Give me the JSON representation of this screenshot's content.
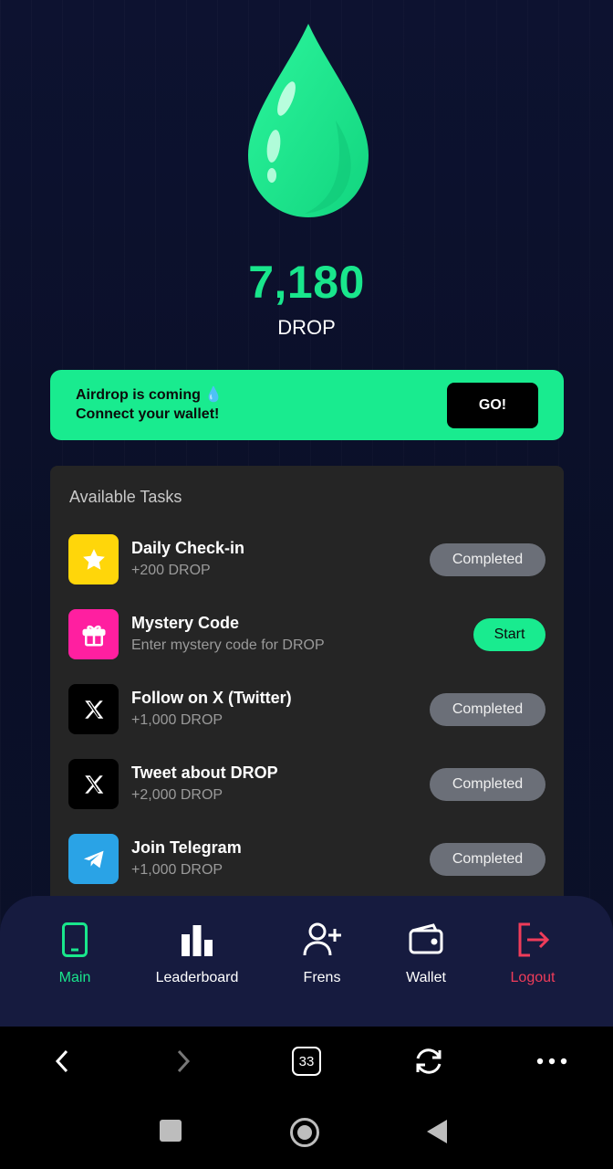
{
  "balance": {
    "amount": "7,180",
    "unit": "DROP"
  },
  "banner": {
    "line1": "Airdrop is coming 💧",
    "line2": "Connect your wallet!",
    "button": "GO!"
  },
  "tasks": {
    "title": "Available Tasks",
    "items": [
      {
        "name": "Daily Check-in",
        "sub": "+200 DROP",
        "status": "Completed",
        "icon": "star-icon",
        "color": "#ffd60a"
      },
      {
        "name": "Mystery Code",
        "sub": "Enter mystery code for DROP",
        "status": "Start",
        "icon": "gift-icon",
        "color": "#ff1fa0"
      },
      {
        "name": "Follow on X (Twitter)",
        "sub": "+1,000 DROP",
        "status": "Completed",
        "icon": "x-logo-icon",
        "color": "#000000"
      },
      {
        "name": "Tweet about DROP",
        "sub": "+2,000 DROP",
        "status": "Completed",
        "icon": "x-logo-icon",
        "color": "#000000"
      },
      {
        "name": "Join Telegram",
        "sub": "+1,000 DROP",
        "status": "Completed",
        "icon": "telegram-icon",
        "color": "#2aa3e6"
      }
    ]
  },
  "nav": {
    "items": [
      {
        "label": "Main",
        "icon": "phone-icon",
        "color": "#19e68c"
      },
      {
        "label": "Leaderboard",
        "icon": "bar-chart-icon",
        "color": "#ffffff"
      },
      {
        "label": "Frens",
        "icon": "add-user-icon",
        "color": "#ffffff"
      },
      {
        "label": "Wallet",
        "icon": "wallet-icon",
        "color": "#ffffff"
      },
      {
        "label": "Logout",
        "icon": "logout-icon",
        "color": "#ef3c5a"
      }
    ]
  },
  "browser": {
    "tab_count": "33"
  },
  "colors": {
    "accent": "#19eb8f",
    "background": "#0b0f24",
    "panel": "#252525",
    "logout": "#ef3c5a"
  }
}
